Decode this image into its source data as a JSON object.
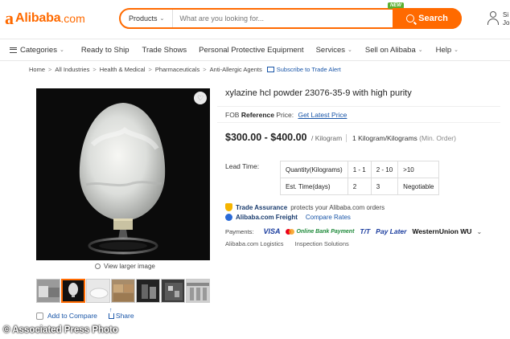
{
  "header": {
    "logo_mark": "a",
    "logo_text": "Alibaba",
    "logo_suffix": ".com",
    "search_category": "Products",
    "search_placeholder": "What are you looking for...",
    "new_badge": "NEW",
    "search_button": "Search",
    "user_line1": "Si",
    "user_line2": "Jo"
  },
  "nav": {
    "categories": "Categories",
    "items": [
      "Ready to Ship",
      "Trade Shows",
      "Personal Protective Equipment",
      "Services",
      "Sell on Alibaba",
      "Help"
    ]
  },
  "breadcrumb": {
    "items": [
      "Home",
      "All Industries",
      "Health & Medical",
      "Pharmaceuticals",
      "Anti-Allergic Agents"
    ],
    "subscribe": "Subscribe to Trade Alert"
  },
  "gallery": {
    "view_larger": "View larger image",
    "add_to_compare": "Add to Compare",
    "share": "Share",
    "thumb_count": 7,
    "active_thumb": 2
  },
  "product": {
    "title": "xylazine hcl powder 23076-35-9 with high purity",
    "fob_prefix": "FOB",
    "fob_reference": "Reference",
    "fob_price_label": "Price:",
    "fob_link": "Get Latest Price",
    "price_range": "$300.00 - $400.00",
    "price_unit": "/ Kilogram",
    "min_order_qty": "1 Kilogram/Kilograms",
    "min_order_label": "(Min. Order)",
    "lead_time_label": "Lead Time:",
    "lead_time_table": {
      "rows": [
        [
          "Quantity(Kilograms)",
          "1 - 1",
          "2 - 10",
          ">10"
        ],
        [
          "Est. Time(days)",
          "2",
          "3",
          "Negotiable"
        ]
      ]
    },
    "trade_assurance_label": "Trade Assurance",
    "trade_assurance_text": "protects your Alibaba.com orders",
    "freight_label": "Alibaba.com Freight",
    "freight_link": "Compare Rates",
    "payments_label": "Payments:",
    "payments": {
      "visa": "VISA",
      "online": "Online Bank Payment",
      "tt": "T/T",
      "pay_later": "Pay Later",
      "wu": "WesternUnion WU"
    },
    "services": [
      "Alibaba.com Logistics",
      "Inspection Solutions"
    ]
  },
  "watermark": "© Associated Press Photo",
  "colors": {
    "brand": "#ff6a00",
    "link": "#1a56a8"
  }
}
